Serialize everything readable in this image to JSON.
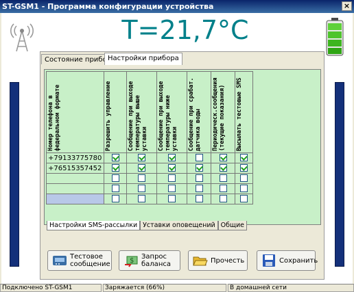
{
  "window": {
    "title": "ST-GSM1 - Программа конфигурации устройства",
    "close": "×"
  },
  "temperature": "T=21,7°C",
  "tabs": [
    "Состояние прибора",
    "Настройки прибора"
  ],
  "table": {
    "headers": [
      "Номер телефона в федеральном формате",
      "Разрешить управление",
      "Сообщение при выходе температуры выше уставки",
      "Сообщение при выходе температуры ниже уставки",
      "Сообщение при срабат. датчика воды",
      "Периодическ.сообщения (текущие показания)",
      "Высылать тестовые SMS"
    ],
    "rows": [
      {
        "phone": "+79133775780",
        "checks": [
          true,
          true,
          true,
          true,
          true,
          true
        ]
      },
      {
        "phone": "+76515357452",
        "checks": [
          true,
          true,
          true,
          true,
          true,
          true
        ]
      },
      {
        "phone": "",
        "checks": [
          false,
          false,
          false,
          false,
          false,
          false
        ]
      },
      {
        "phone": "",
        "checks": [
          false,
          false,
          false,
          false,
          false,
          false
        ]
      },
      {
        "phone": "",
        "checks": [
          false,
          false,
          false,
          false,
          false,
          false
        ]
      }
    ]
  },
  "bottom_tabs": [
    "Настройки SMS-рассылки",
    "Уставки оповещений",
    "Общие"
  ],
  "buttons": {
    "test_sms": "Тестовое сообщение",
    "balance": "Запрос баланса",
    "read": "Прочесть",
    "save": "Сохранить"
  },
  "status": {
    "connection": "Подключено ST-GSM1",
    "charging": "Заряжается (66%)",
    "network": "В домашней сети"
  },
  "colors": {
    "titlebar": "#0a246a",
    "temperature": "#00808a",
    "grid_bg": "#c8f0c8",
    "sidebar": "#14307a"
  }
}
